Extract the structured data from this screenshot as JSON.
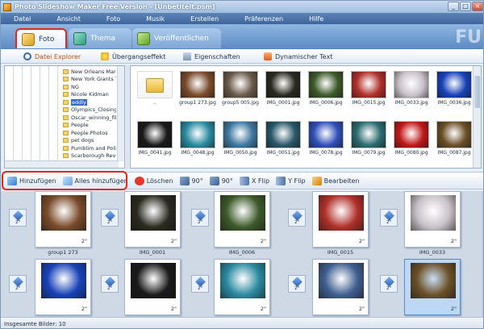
{
  "window": {
    "title": "Photo Slideshow Maker Free Version - [Unbetitelt.psm]",
    "brand_text": "FU",
    "controls": [
      "_",
      "□",
      "×"
    ]
  },
  "menu": [
    "Datei",
    "Ansicht",
    "Foto",
    "Musik",
    "Erstellen",
    "Präferenzen",
    "Hilfe"
  ],
  "tabs": [
    {
      "label": "Foto",
      "icon": "photo-icon",
      "active": true
    },
    {
      "label": "Thema",
      "icon": "shirt-icon"
    },
    {
      "label": "Veröffentlichen",
      "icon": "publish-icon"
    }
  ],
  "subtabs": [
    {
      "label": "Datei Explorer",
      "icon": "magnifier-icon",
      "active": true
    },
    {
      "label": "Übergangseffekt",
      "icon": "star-icon"
    },
    {
      "label": "Eigenschaften",
      "icon": "properties-icon"
    },
    {
      "label": "Dynamischer Text",
      "icon": "text-icon"
    }
  ],
  "tree": [
    "New Orleans Mardi",
    "New York Giants Tr",
    "NG",
    "Nicole Kidman",
    "eddly",
    "Olympics_Closing_C",
    "Oscar_winning_film",
    "People",
    "People Photos",
    "pet dogs",
    "Pumblim and Police",
    "Scarborough Reve"
  ],
  "tree_selected": "eddly",
  "files": [
    {
      "name": "..",
      "kind": "folder"
    },
    {
      "name": "group1 273.jpg",
      "color": "#7a4b2b"
    },
    {
      "name": "group5 005.jpg",
      "color": "#6b5b4a"
    },
    {
      "name": "IMG_0001.jpg",
      "color": "#2a2a20"
    },
    {
      "name": "IMG_0006.jpg",
      "color": "#3d5a2a"
    },
    {
      "name": "IMG_0015.jpg",
      "color": "#b0302a"
    },
    {
      "name": "IMG_0033.jpg",
      "color": "#c9c2c8"
    },
    {
      "name": "IMG_0036.jpg",
      "color": "#1842b8"
    },
    {
      "name": "IMG_0041.jpg",
      "color": "#1a1a1a"
    },
    {
      "name": "IMG_0048.jpg",
      "color": "#2a8aa0"
    },
    {
      "name": "IMG_0050.jpg",
      "color": "#3f78a0"
    },
    {
      "name": "IMG_0051.jpg",
      "color": "#285868"
    },
    {
      "name": "IMG_0078.jpg",
      "color": "#3050b8"
    },
    {
      "name": "IMG_0079.jpg",
      "color": "#2b6b70"
    },
    {
      "name": "IMG_0080.jpg",
      "color": "#c01818"
    },
    {
      "name": "IMG_0087.jpg",
      "color": "#6b5028"
    }
  ],
  "toolbar": {
    "add": "Hinzufügen",
    "add_all": "Alles hinzufügen",
    "delete": "Löschen",
    "rot_left": "90°",
    "rot_right": "90°",
    "xflip": "X Flip",
    "yflip": "Y Flip",
    "edit": "Bearbeiten"
  },
  "story": {
    "row1": [
      {
        "name": "group1 273",
        "dur": "2\"",
        "color": "#7a4b2b"
      },
      {
        "name": "IMG_0001",
        "dur": "2\"",
        "color": "#2a2a20"
      },
      {
        "name": "IMG_0006",
        "dur": "2\"",
        "color": "#3d5a2a"
      },
      {
        "name": "IMG_0015",
        "dur": "2\"",
        "color": "#b0302a"
      },
      {
        "name": "IMG_0033",
        "dur": "2\"",
        "color": "#c9c2c8"
      }
    ],
    "row2": [
      {
        "dur": "2\"",
        "color": "#1842b8"
      },
      {
        "dur": "2\"",
        "color": "#1a1a1a"
      },
      {
        "dur": "2\"",
        "color": "#2a8aa0"
      },
      {
        "dur": "2\"",
        "color": "#3f5f90"
      },
      {
        "dur": "2\"",
        "color": "#6b5028",
        "selected": true
      }
    ],
    "transition_dur": "2\""
  },
  "status": "Insgesamte Bilder: 10"
}
